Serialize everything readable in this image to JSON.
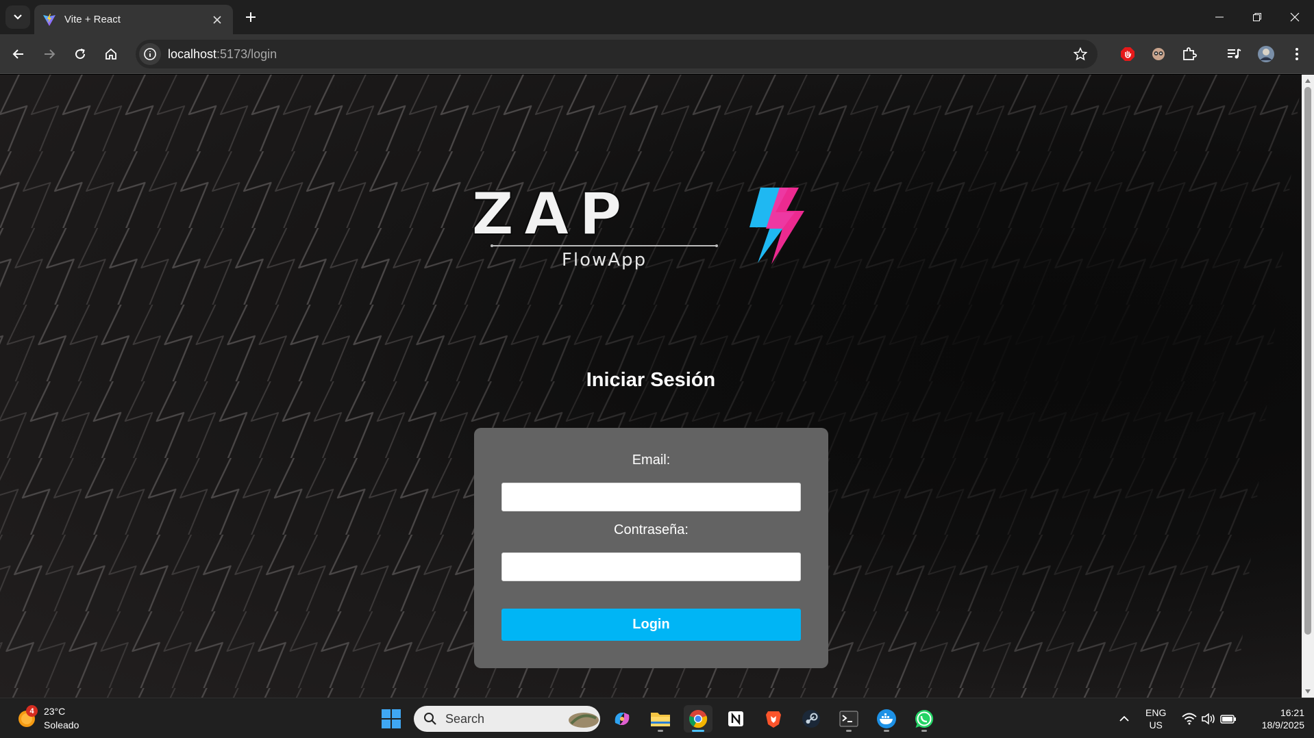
{
  "browser": {
    "tab_title": "Vite + React",
    "url_host": "localhost",
    "url_rest": ":5173/login"
  },
  "page": {
    "title": "Iniciar Sesión",
    "logo_text": "ZAP",
    "logo_subtext": "FlowApp",
    "email_label": "Email:",
    "email_value": "",
    "password_label": "Contraseña:",
    "password_value": "",
    "login_button": "Login"
  },
  "taskbar": {
    "weather_temp": "23°C",
    "weather_desc": "Soleado",
    "weather_badge": "4",
    "search_placeholder": "Search",
    "lang_top": "ENG",
    "lang_bottom": "US",
    "time": "16:21",
    "date": "18/9/2025"
  },
  "colors": {
    "accent": "#00b5f5",
    "card": "#636363",
    "logo_cyan": "#1fb8f2",
    "logo_pink": "#ff2d9b"
  },
  "icons": [
    "tab-search-icon",
    "vite-favicon",
    "close-icon",
    "plus-icon",
    "minimize-icon",
    "restore-icon",
    "window-close-icon",
    "back-icon",
    "forward-icon",
    "reload-icon",
    "home-icon",
    "site-info-icon",
    "star-icon",
    "extension-icon",
    "puzzle-icon",
    "media-icon",
    "profile-avatar",
    "more-icon",
    "weather-icon",
    "windows-start-icon",
    "search-icon",
    "copilot-icon",
    "file-explorer-icon",
    "chrome-icon",
    "notion-icon",
    "brave-icon",
    "steam-icon",
    "terminal-icon",
    "docker-icon",
    "whatsapp-icon",
    "chevron-up-icon",
    "wifi-icon",
    "volume-icon",
    "battery-icon"
  ]
}
